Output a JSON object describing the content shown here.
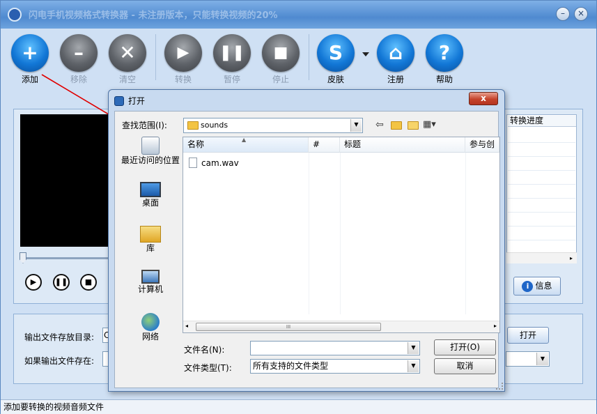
{
  "app": {
    "title": "闪电手机视频格式转换器 - 未注册版本，只能转换视频的20%",
    "minimize": "–",
    "close": "×"
  },
  "toolbar": {
    "add": "添加",
    "remove": "移除",
    "clear": "清空",
    "convert": "转换",
    "pause": "暂停",
    "stop": "停止",
    "skin": "皮肤",
    "register": "注册",
    "help": "帮助"
  },
  "file_table": {
    "progress_header": "转换进度"
  },
  "info_button": "信息",
  "output": {
    "dir_label": "输出文件存放目录:",
    "dir_value": "C",
    "exists_label": "如果输出文件存在:",
    "exists_value": "",
    "open_button": "打开"
  },
  "status": "添加要转换的视频音频文件",
  "dialog": {
    "title": "打开",
    "close": "x",
    "look_in_label": "查找范围(I):",
    "look_in_value": "sounds",
    "places": [
      "最近访问的位置",
      "桌面",
      "库",
      "计算机",
      "网络"
    ],
    "columns": [
      "名称",
      "#",
      "标题",
      "参与创"
    ],
    "files": [
      "cam.wav"
    ],
    "file_name_label": "文件名(N):",
    "file_name_value": "",
    "file_type_label": "文件类型(T):",
    "file_type_value": "所有支持的文件类型",
    "open_button": "打开(O)",
    "cancel_button": "取消"
  },
  "colors": {
    "accent_blue": "#1277d6",
    "disabled_grey": "#5e6268",
    "annotation_red": "#e00000"
  }
}
